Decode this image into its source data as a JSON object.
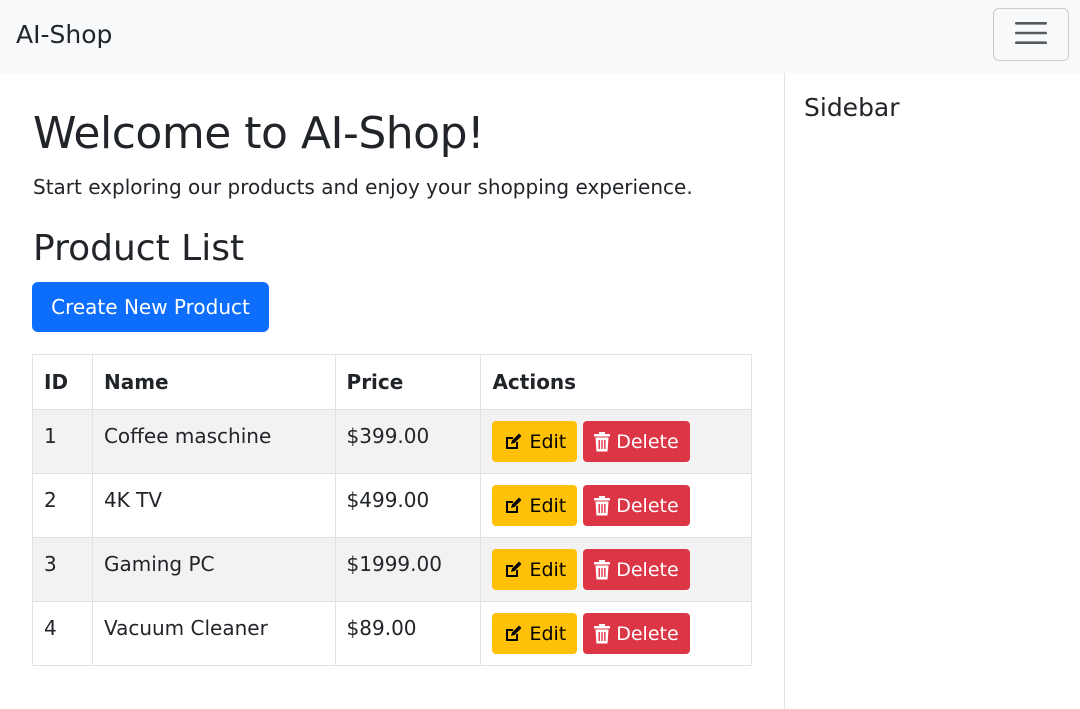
{
  "navbar": {
    "brand": "AI-Shop",
    "toggler_icon": "hamburger-menu-icon",
    "background": "#f8f9fa"
  },
  "main": {
    "welcome_title": "Welcome to AI-Shop!",
    "welcome_text": "Start exploring our products and enjoy your shopping experience.",
    "list_title": "Product List",
    "create_button": "Create New Product"
  },
  "table": {
    "headers": [
      "ID",
      "Name",
      "Price",
      "Actions"
    ],
    "rows": [
      {
        "id": "1",
        "name": "Coffee maschine",
        "price": "$399.00"
      },
      {
        "id": "2",
        "name": "4K TV",
        "price": "$499.00"
      },
      {
        "id": "3",
        "name": "Gaming PC",
        "price": "$1999.00"
      },
      {
        "id": "4",
        "name": "Vacuum Cleaner",
        "price": "$89.00"
      }
    ],
    "edit_label": "Edit",
    "delete_label": "Delete",
    "edit_icon": "edit-icon",
    "delete_icon": "trash-icon"
  },
  "sidebar": {
    "title": "Sidebar"
  },
  "colors": {
    "primary": "#0d6efd",
    "warning": "#ffc107",
    "danger": "#dc3545",
    "striped_row": "#f2f2f2"
  }
}
